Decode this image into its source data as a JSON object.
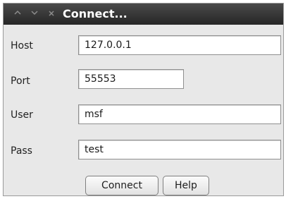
{
  "window": {
    "title": "Connect...",
    "controls": {
      "maximize_icon": "chevron-up-icon",
      "minimize_icon": "chevron-down-icon",
      "close_icon": "close-icon"
    }
  },
  "form": {
    "host_label": "Host",
    "host_value": "127.0.0.1",
    "port_label": "Port",
    "port_value": "55553",
    "user_label": "User",
    "user_value": "msf",
    "pass_label": "Pass",
    "pass_value": "test"
  },
  "buttons": {
    "connect_label": "Connect",
    "help_label": "Help"
  },
  "colors": {
    "titlebar": "#2e2e2e",
    "title_text": "#ffffff",
    "dialog_background": "#e8e8e8"
  }
}
